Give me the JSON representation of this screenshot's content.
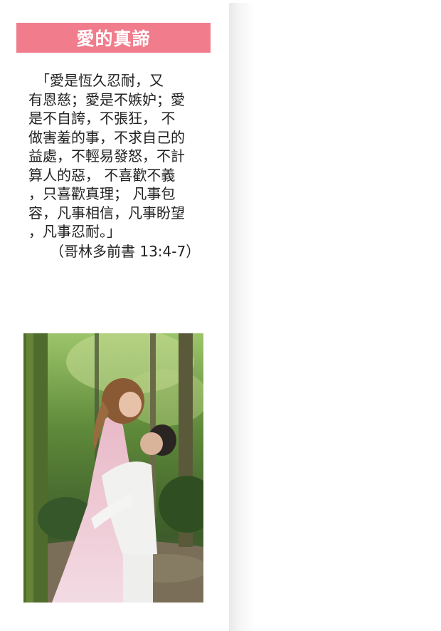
{
  "section": {
    "title": "愛的真諦",
    "verse_lines": [
      "　「愛是恆久忍耐，又",
      "有恩慈；愛是不嫉妒；愛",
      "是不自誇，不張狂， 不",
      "做害羞的事，不求自己的",
      "益處，不輕易發怒，不計",
      "算人的惡， 不喜歡不義",
      "，只喜歡真理； 凡事包",
      "容，凡事相信，凡事盼望",
      "，凡事忍耐。」"
    ],
    "reference": "（哥林多前書 13:4-7）"
  },
  "photo": {
    "subject": "wedding couple embracing in forest",
    "icon": "photo-image"
  },
  "colors": {
    "title_background": "#f07c8c",
    "title_text": "#ffffff",
    "body_text": "#222222"
  }
}
